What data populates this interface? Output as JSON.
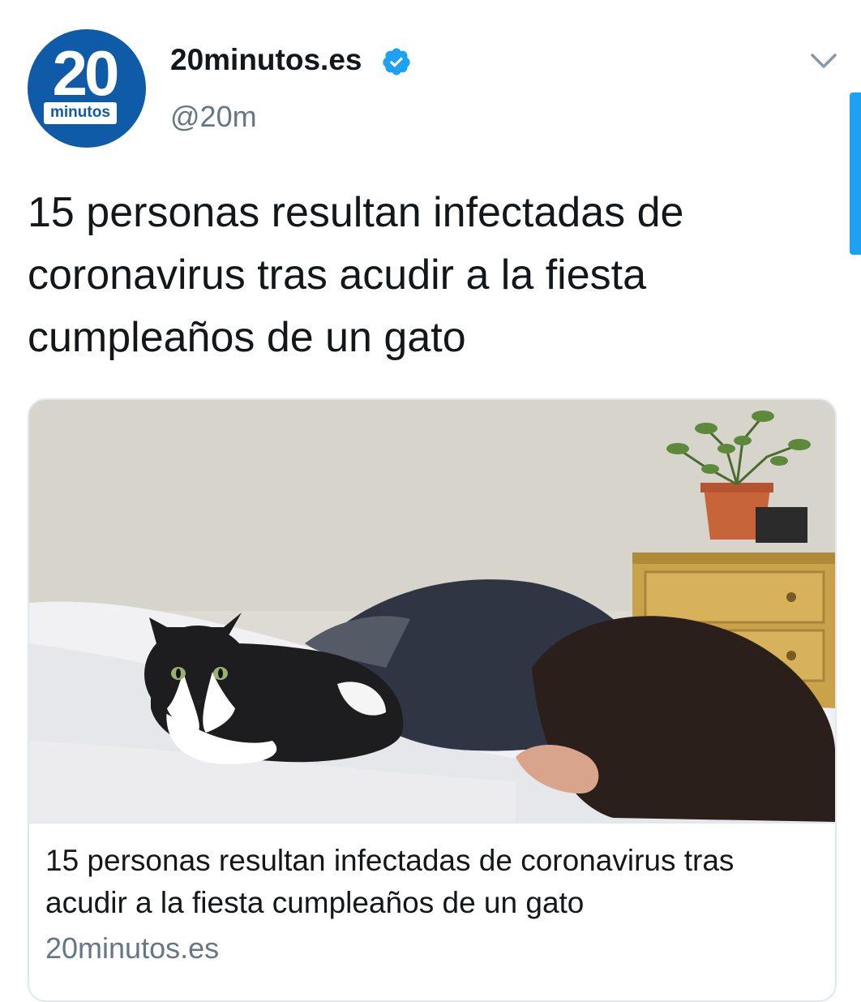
{
  "author": {
    "avatar_number": "20",
    "avatar_word": "minutos",
    "display_name": "20minutos.es",
    "handle": "@20m",
    "verified": true,
    "brand_color": "#0f5ba7"
  },
  "tweet": {
    "text": "15 personas resultan infectadas de coronavirus tras acudir a la fiesta cumpleaños de un gato"
  },
  "card": {
    "title": "15 personas resultan infectadas de coronavirus tras acudir a la fiesta cumpleaños de un gato",
    "domain": "20minutos.es"
  },
  "icons": {
    "verified": "verified-badge-icon",
    "menu": "chevron-down-icon"
  },
  "colors": {
    "accent": "#1da1f2",
    "secondary_text": "#657786",
    "border": "#e1e8ed"
  }
}
